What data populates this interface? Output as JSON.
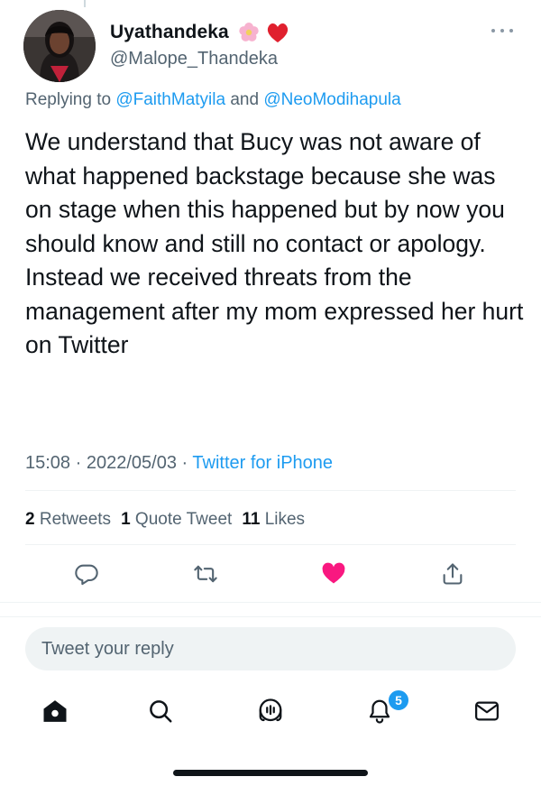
{
  "author": {
    "display_name": "Uyathandeka",
    "handle": "@Malope_Thandeka",
    "name_emojis": [
      "cherry-blossom",
      "red-heart"
    ]
  },
  "reply": {
    "prefix": "Replying to",
    "user1": "@FaithMatyila",
    "connector": "and",
    "user2": "@NeoModihapula"
  },
  "tweet": {
    "text": "We understand that Bucy was not aware of what happened backstage because she was on stage when this happened but by now you should know and still no contact or apology. Instead we received threats from the management after my mom expressed her hurt on Twitter",
    "time": "15:08",
    "separator": "·",
    "date": "2022/05/03",
    "source": "Twitter for iPhone"
  },
  "stats": {
    "retweets_count": "2",
    "retweets_label": "Retweets",
    "quotes_count": "1",
    "quotes_label": "Quote Tweet",
    "likes_count": "11",
    "likes_label": "Likes"
  },
  "actions": [
    {
      "icon": "comment-icon",
      "state": "default"
    },
    {
      "icon": "retweet-icon",
      "state": "default"
    },
    {
      "icon": "heart-icon",
      "state": "liked"
    },
    {
      "icon": "share-icon",
      "state": "default"
    }
  ],
  "reply_box": {
    "placeholder": "Tweet your reply"
  },
  "tab_bar": {
    "items": [
      "home-icon",
      "search-icon",
      "spaces-icon",
      "notifications-icon",
      "messages-icon"
    ],
    "notifications_badge": "5"
  },
  "colors": {
    "accent": "#1d9bf0",
    "like": "#f91880",
    "text_primary": "#0f1419",
    "text_secondary": "#536471"
  }
}
